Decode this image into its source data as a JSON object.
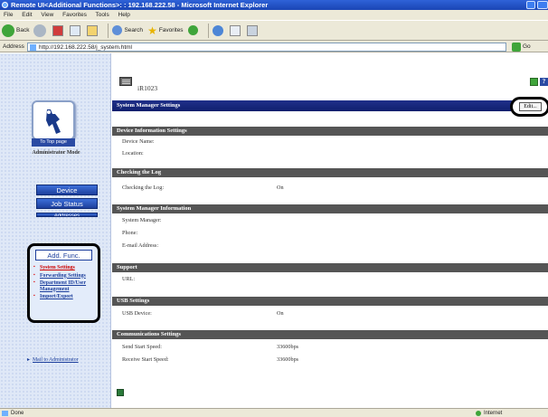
{
  "window": {
    "title": "Remote UI<Additional Functions>: : 192.168.222.58 - Microsoft Internet Explorer"
  },
  "menu": [
    "File",
    "Edit",
    "View",
    "Favorites",
    "Tools",
    "Help"
  ],
  "toolbar": {
    "back_label": "Back",
    "search_label": "Search",
    "favorites_label": "Favorites"
  },
  "address": {
    "label": "Address",
    "url": "http://192.168.222.58/j_system.html",
    "go_label": "Go"
  },
  "sidebar": {
    "top_page": "To Top page",
    "mode": "Administrator Mode",
    "device_btn": "Device",
    "job_status_btn": "Job Status",
    "addresses_btn": "Addresses",
    "add_func_btn": "Add. Func.",
    "submenu": [
      "System Settings",
      "Forwarding Settings",
      "Department ID/User Management",
      "Import/Export"
    ],
    "mail_link": "Mail to Administrator"
  },
  "main": {
    "device_name": "iR1023",
    "page_title": "System Manager Settings",
    "edit_label": "Edit..."
  },
  "sections": [
    {
      "title": "Device Information Settings",
      "rows": [
        {
          "label": "Device Name:",
          "value": ""
        },
        {
          "label": "Location:",
          "value": ""
        }
      ]
    },
    {
      "title": "Checking the Log",
      "rows": [
        {
          "label": "Checking the Log:",
          "value": "On"
        }
      ]
    },
    {
      "title": "System Manager Information",
      "rows": [
        {
          "label": "System Manager:",
          "value": ""
        },
        {
          "label": "Phone:",
          "value": ""
        },
        {
          "label": "E-mail Address:",
          "value": ""
        }
      ]
    },
    {
      "title": "Support",
      "rows": [
        {
          "label": "URL:",
          "value": ""
        }
      ]
    },
    {
      "title": "USB Settings",
      "rows": [
        {
          "label": "USB Device:",
          "value": "On"
        }
      ]
    },
    {
      "title": "Communications Settings",
      "rows": [
        {
          "label": "Send Start Speed:",
          "value": "33600bps"
        },
        {
          "label": "Receive Start Speed:",
          "value": "33600bps"
        }
      ]
    }
  ],
  "status": {
    "left": "Done",
    "zone": "Internet"
  }
}
